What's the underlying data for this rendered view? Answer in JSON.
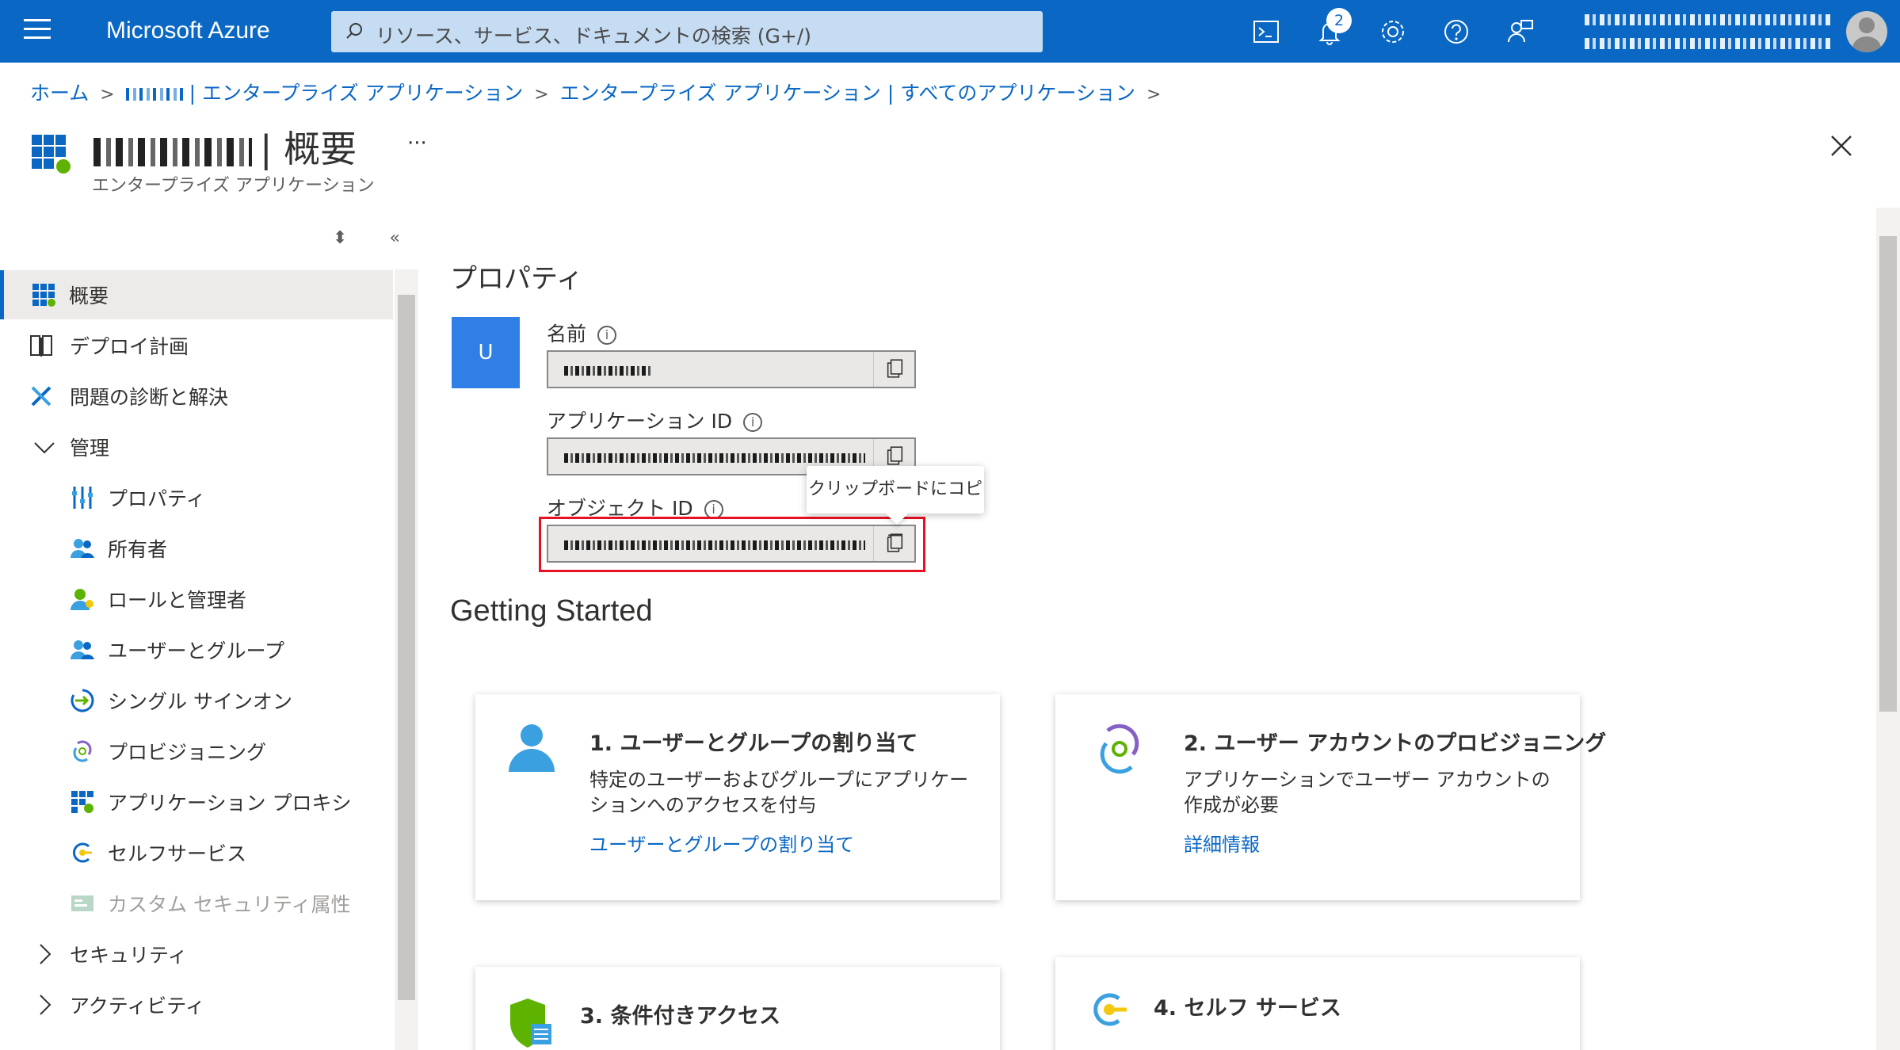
{
  "header": {
    "brand": "Microsoft Azure",
    "search_placeholder": "リソース、サービス、ドキュメントの検索 (G+/)",
    "notification_count": "2"
  },
  "breadcrumb": {
    "home": "ホーム",
    "item2": "| エンタープライズ アプリケーション",
    "item3": "エンタープライズ アプリケーション | すべてのアプリケーション"
  },
  "page": {
    "title_suffix": "| 概要",
    "subtitle": "エンタープライズ アプリケーション",
    "more": "···"
  },
  "sidebar": {
    "items": [
      {
        "label": "概要",
        "icon": "grid-icon"
      },
      {
        "label": "デプロイ計画",
        "icon": "book-icon"
      },
      {
        "label": "問題の診断と解決",
        "icon": "wrench-icon"
      },
      {
        "label": "管理",
        "icon": "chevron-down-icon"
      },
      {
        "label": "プロパティ",
        "icon": "properties-icon"
      },
      {
        "label": "所有者",
        "icon": "people-icon"
      },
      {
        "label": "ロールと管理者",
        "icon": "role-icon"
      },
      {
        "label": "ユーザーとグループ",
        "icon": "people-icon"
      },
      {
        "label": "シングル サインオン",
        "icon": "sso-icon"
      },
      {
        "label": "プロビジョニング",
        "icon": "provisioning-icon"
      },
      {
        "label": "アプリケーション プロキシ",
        "icon": "proxy-icon"
      },
      {
        "label": "セルフサービス",
        "icon": "self-service-icon"
      },
      {
        "label": "カスタム セキュリティ属性",
        "icon": "custom-attr-icon"
      },
      {
        "label": "セキュリティ",
        "icon": "chevron-right-icon"
      },
      {
        "label": "アクティビティ",
        "icon": "chevron-right-icon"
      }
    ]
  },
  "properties": {
    "heading": "プロパティ",
    "avatar_letter": "U",
    "name_label": "名前",
    "app_id_label": "アプリケーション ID",
    "object_id_label": "オブジェクト ID",
    "tooltip": "クリップボードにコピー"
  },
  "getting_started": {
    "heading": "Getting Started",
    "cards": [
      {
        "title": "1. ユーザーとグループの割り当て",
        "desc": "特定のユーザーおよびグループにアプリケーションへのアクセスを付与",
        "link": "ユーザーとグループの割り当て"
      },
      {
        "title": "2. ユーザー アカウントのプロビジョニング",
        "desc": "アプリケーションでユーザー アカウントの作成が必要",
        "link": "詳細情報"
      },
      {
        "title": "3. 条件付きアクセス",
        "desc": "",
        "link": ""
      },
      {
        "title": "4. セルフ サービス",
        "desc": "",
        "link": ""
      }
    ]
  },
  "colors": {
    "accent": "#0a68c4",
    "highlight": "#e81123"
  }
}
